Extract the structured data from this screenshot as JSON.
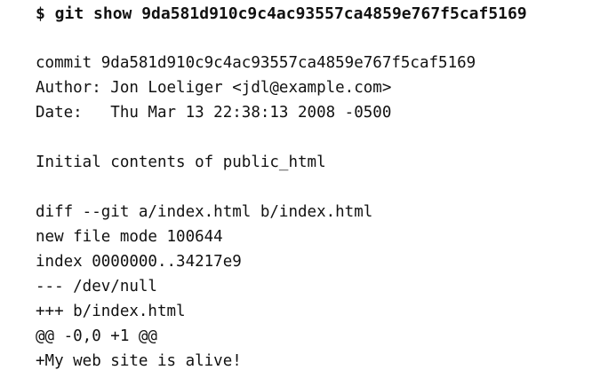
{
  "command": "$ git show 9da581d910c9c4ac93557ca4859e767f5caf5169",
  "commit_header": {
    "commit": "commit 9da581d910c9c4ac93557ca4859e767f5caf5169",
    "author": "Author: Jon Loeliger <jdl@example.com>",
    "date": "Date:   Thu Mar 13 22:38:13 2008 -0500"
  },
  "message": "Initial contents of public_html",
  "diff": {
    "header": "diff --git a/index.html b/index.html",
    "mode": "new file mode 100644",
    "index": "index 0000000..34217e9",
    "old_file": "--- /dev/null",
    "new_file": "+++ b/index.html",
    "hunk": "@@ -0,0 +1 @@",
    "added_line": "+My web site is alive!"
  }
}
